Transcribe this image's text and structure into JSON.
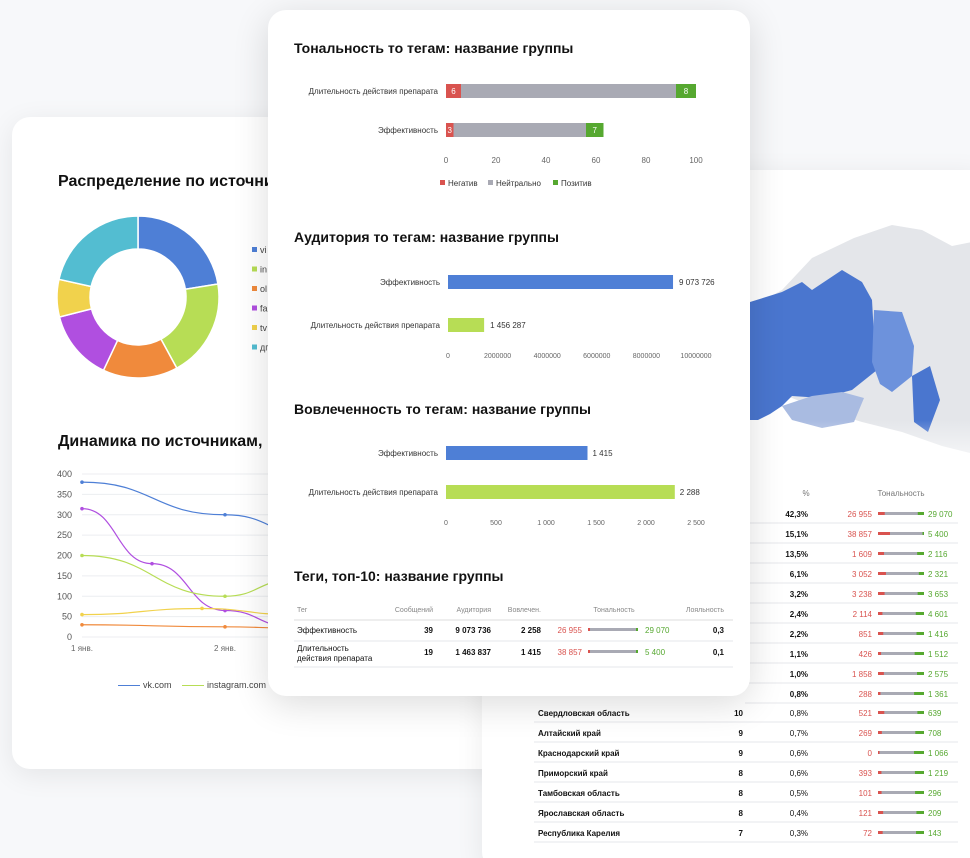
{
  "left_card": {
    "donut_title": "Распределение по источни",
    "donut_colors": [
      "#4e7fd6",
      "#b7dd55",
      "#f08a3c",
      "#b04fe0",
      "#f1d24c",
      "#53bdd1"
    ],
    "donut_values": [
      24,
      21,
      16,
      15,
      8,
      23
    ],
    "donut_legend": [
      "vi",
      "in",
      "ol",
      "fa",
      "tv",
      "дг"
    ],
    "line_title": "Динамика по источникам, ",
    "y_ticks": [
      "400",
      "350",
      "300",
      "250",
      "200",
      "150",
      "100",
      "50",
      "0"
    ],
    "x_ticks": [
      "1 янв.",
      "2 янв."
    ],
    "legend": [
      "vk.com",
      "instagram.com"
    ]
  },
  "center_card": {
    "sentiment": {
      "title": "Тональность то тегам: название группы",
      "rows": [
        {
          "label": "Длительность действия препарата",
          "neg": 6,
          "neu": 86,
          "pos": 8,
          "neg_label": "6",
          "pos_label": "8"
        },
        {
          "label": "Эффективность",
          "neg": 3,
          "neu": 53,
          "pos": 7,
          "neg_label": "3",
          "pos_label": "7"
        }
      ],
      "x_ticks": [
        "0",
        "20",
        "40",
        "60",
        "80",
        "100"
      ],
      "legend": [
        "Негатив",
        "Нейтрально",
        "Позитив"
      ],
      "colors": {
        "neg": "#d9534f",
        "neu": "#a9aab4",
        "pos": "#56a830"
      }
    },
    "audience": {
      "title": "Аудитория то тегам: название группы",
      "rows": [
        {
          "label": "Эффективность",
          "value": 9073726,
          "text": "9 073 726",
          "color": "#4e7fd6"
        },
        {
          "label": "Длительность действия препарата",
          "value": 1456287,
          "text": "1 456 287",
          "color": "#b7dd55"
        }
      ],
      "x_ticks": [
        "0",
        "2000000",
        "4000000",
        "6000000",
        "8000000",
        "10000000"
      ]
    },
    "engagement": {
      "title": "Вовлеченность то тегам: название группы",
      "rows": [
        {
          "label": "Эффективность",
          "value": 1415,
          "text": "1 415",
          "color": "#4e7fd6"
        },
        {
          "label": "Длительность действия препарата",
          "value": 2288,
          "text": "2 288",
          "color": "#b7dd55"
        }
      ],
      "x_ticks": [
        "0",
        "500",
        "1 000",
        "1 500",
        "2 000",
        "2 500"
      ]
    },
    "tags": {
      "title": "Теги, топ-10: название группы",
      "headers": [
        "Тег",
        "Сообщений",
        "Аудитория",
        "Вовлечен.",
        "Тональность",
        "Лояльность"
      ],
      "rows": [
        {
          "tag": "Эффективность",
          "messages": "39",
          "audience": "9 073 736",
          "engagement": "2 258",
          "neg": "26 955",
          "pos": "29 070",
          "loyalty": "0,3"
        },
        {
          "tag": "Длительность действия препарата",
          "messages": "19",
          "audience": "1 463 837",
          "engagement": "1 415",
          "neg": "38 857",
          "pos": "5 400",
          "loyalty": "0,1"
        }
      ]
    }
  },
  "right_card": {
    "headers": [
      "%",
      "Тональность"
    ],
    "rows_top": [
      {
        "pct": "42,3%",
        "neg": "26 955",
        "pos": "29 070"
      },
      {
        "pct": "15,1%",
        "neg": "38 857",
        "pos": "5 400"
      },
      {
        "pct": "13,5%",
        "neg": "1 609",
        "pos": "2 116"
      },
      {
        "pct": "6,1%",
        "neg": "3 052",
        "pos": "2 321"
      },
      {
        "pct": "3,2%",
        "neg": "3 238",
        "pos": "3 653"
      },
      {
        "pct": "2,4%",
        "neg": "2 114",
        "pos": "4 601"
      },
      {
        "pct": "2,2%",
        "neg": "851",
        "pos": "1 416"
      },
      {
        "pct": "1,1%",
        "neg": "426",
        "pos": "1 512"
      },
      {
        "pct": "1,0%",
        "neg": "1 858",
        "pos": "2 575"
      },
      {
        "pct": "0,8%",
        "neg": "288",
        "pos": "1 361"
      }
    ],
    "rows_named": [
      {
        "region": "Свердловская область",
        "count": "10",
        "pct": "0,8%",
        "neg": "521",
        "pos": "639"
      },
      {
        "region": "Алтайский край",
        "count": "9",
        "pct": "0,7%",
        "neg": "269",
        "pos": "708"
      },
      {
        "region": "Краснодарский край",
        "count": "9",
        "pct": "0,6%",
        "neg": "0",
        "pos": "1 066"
      },
      {
        "region": "Приморский край",
        "count": "8",
        "pct": "0,6%",
        "neg": "393",
        "pos": "1 219"
      },
      {
        "region": "Тамбовская область",
        "count": "8",
        "pct": "0,5%",
        "neg": "101",
        "pos": "296"
      },
      {
        "region": "Ярославская область",
        "count": "8",
        "pct": "0,4%",
        "neg": "121",
        "pos": "209"
      },
      {
        "region": "Республика Карелия",
        "count": "7",
        "pct": "0,3%",
        "neg": "72",
        "pos": "143"
      }
    ]
  }
}
